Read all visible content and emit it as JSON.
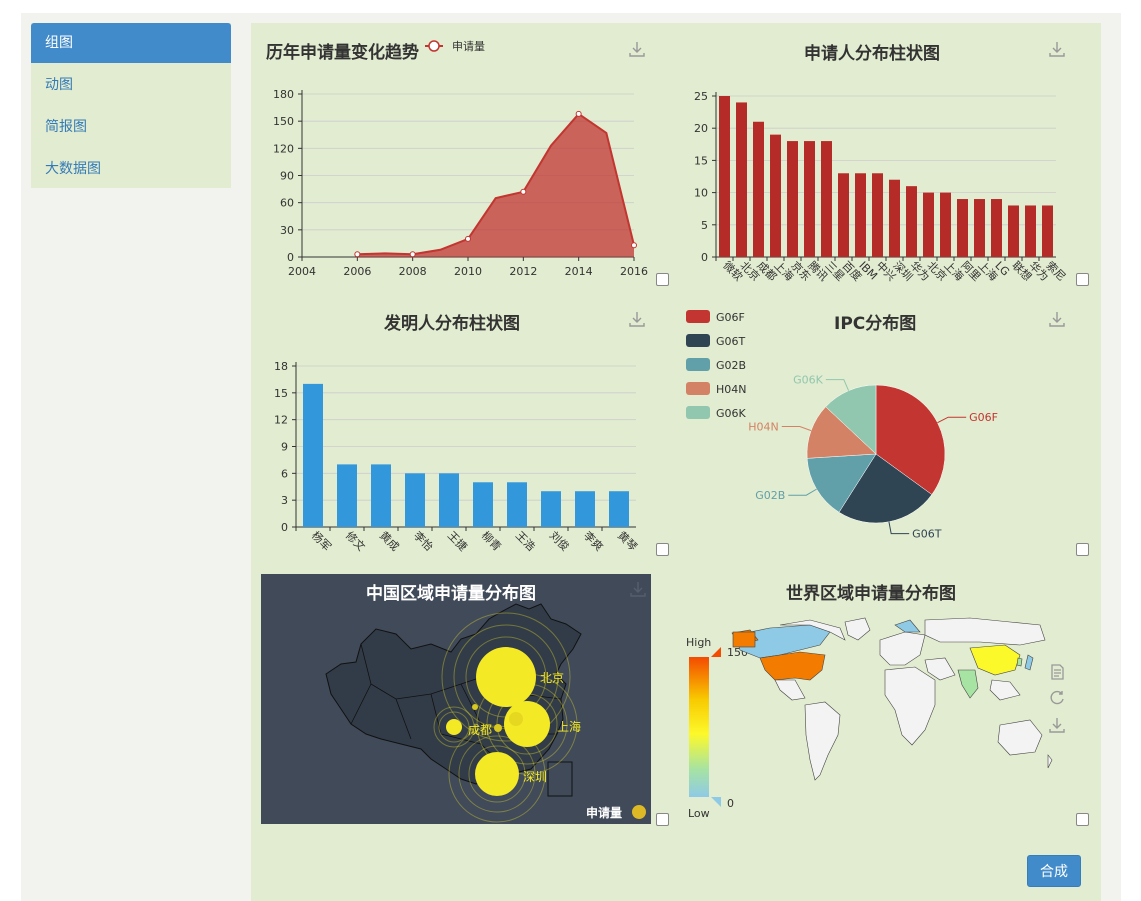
{
  "sidebar": {
    "items": [
      {
        "label": "组图",
        "active": true
      },
      {
        "label": "动图"
      },
      {
        "label": "简报图"
      },
      {
        "label": "大数据图"
      }
    ]
  },
  "colors": {
    "accent": "#428bca",
    "panel_bg": "#e2ecd0",
    "area_red": "#c23531",
    "bar_blue": "#3398db",
    "dark_map_bg": "#404a59",
    "bubble_yellow": "#f4e925"
  },
  "panels": {
    "trend": {
      "title": "历年申请量变化趋势",
      "legend": "申请量"
    },
    "applicant": {
      "title": "申请人分布柱状图"
    },
    "inventor": {
      "title": "发明人分布柱状图"
    },
    "ipc": {
      "title": "IPC分布图"
    },
    "china": {
      "title": "中国区域申请量分布图",
      "legend": "申请量",
      "cities": [
        "北京",
        "上海",
        "成都",
        "深圳"
      ]
    },
    "world": {
      "title": "世界区域申请量分布图",
      "high": "High",
      "low": "Low",
      "max": "150",
      "min": "0"
    }
  },
  "merge_button": "合成",
  "chart_data": [
    {
      "type": "area",
      "title": "历年申请量变化趋势",
      "series": [
        {
          "name": "申请量",
          "x": [
            2006,
            2007,
            2008,
            2009,
            2010,
            2011,
            2012,
            2013,
            2014,
            2015,
            2016
          ],
          "values": [
            3,
            4,
            3,
            8,
            20,
            65,
            72,
            123,
            158,
            137,
            13
          ]
        }
      ],
      "xlim": [
        2004,
        2016
      ],
      "ylim": [
        0,
        180
      ],
      "yticks": [
        0,
        30,
        60,
        90,
        120,
        150,
        180
      ],
      "xticks": [
        2004,
        2006,
        2008,
        2010,
        2012,
        2014,
        2016
      ],
      "legend": "top"
    },
    {
      "type": "bar",
      "title": "申请人分布柱状图",
      "categories": [
        "微软",
        "北京",
        "成都",
        "上海",
        "京东",
        "腾讯",
        "三星",
        "百度",
        "IBM",
        "中兴",
        "深圳",
        "华为",
        "北京",
        "上海",
        "阿里",
        "上海",
        "LG",
        "联想",
        "华为",
        "索尼"
      ],
      "values": [
        25,
        24,
        21,
        19,
        18,
        18,
        18,
        13,
        13,
        13,
        12,
        11,
        10,
        10,
        9,
        9,
        9,
        8,
        8,
        8
      ],
      "ylim": [
        0,
        25
      ],
      "yticks": [
        0,
        5,
        10,
        15,
        20,
        25
      ]
    },
    {
      "type": "bar",
      "title": "发明人分布柱状图",
      "categories": [
        "杨军",
        "修文",
        "黄成",
        "李怡",
        "王捷",
        "柳青",
        "王浩",
        "刘俊",
        "李爽",
        "黄琴"
      ],
      "values": [
        16,
        7,
        7,
        6,
        6,
        5,
        5,
        4,
        4,
        4
      ],
      "ylim": [
        0,
        18
      ],
      "yticks": [
        0,
        3,
        6,
        9,
        12,
        15,
        18
      ]
    },
    {
      "type": "pie",
      "title": "IPC分布图",
      "categories": [
        "G06F",
        "G06T",
        "G02B",
        "H04N",
        "G06K"
      ],
      "values": [
        35,
        24,
        15,
        13,
        13
      ],
      "colors": [
        "#c23531",
        "#2f4554",
        "#61a0a8",
        "#d48265",
        "#91c7ae"
      ],
      "legend": "top-left"
    }
  ]
}
